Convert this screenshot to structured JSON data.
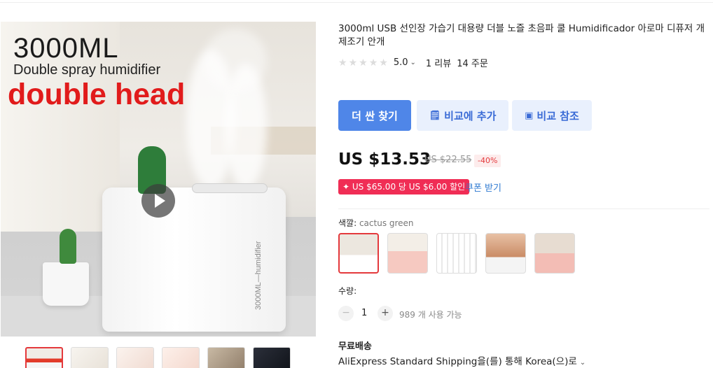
{
  "gallery": {
    "image_texts": {
      "headline": "3000ML",
      "subline": "Double spray humidifier",
      "highlight": "double head",
      "device_label": "3000ML—humidifier"
    },
    "thumbnail_count": 6
  },
  "product": {
    "title": "3000ml USB 선인장 가습기 대용량 더블 노즐 초음파 쿨 Humidificador 아로마 디퓨저 개 제조기 안개",
    "rating": "5.0",
    "stars": 5,
    "reviews": "1 리뷰",
    "orders": "14 주문"
  },
  "actions": {
    "find_cheaper": "더 싼 찾기",
    "add_compare": "비교에 추가",
    "view_compare": "비교 참조"
  },
  "pricing": {
    "price": "US $13.53",
    "original_price": "US $22.55",
    "discount": "-40%",
    "coupon": "✦ US $65.00 당 US $6.00 할인",
    "coupon_link": "쿠폰 받기"
  },
  "variants": {
    "label": "색깔:",
    "selected": "cactus green",
    "count": 5
  },
  "quantity": {
    "label": "수량:",
    "value": "1",
    "minus": "−",
    "plus": "+",
    "available": "989 개 사용 가능"
  },
  "shipping": {
    "title": "무료배송",
    "description": "AliExpress Standard Shipping을(를) 통해 Korea(으)로"
  },
  "colors": {
    "accent_red": "#e4393c",
    "primary_blue": "#4f86e8",
    "coupon_pink": "#f02d55",
    "link_blue": "#2f7ad1"
  },
  "icons": {
    "rating_chevron": "chevron-down-icon",
    "compare_add": "compare-add-icon",
    "compare_view": "compare-view-icon",
    "play": "play-icon"
  }
}
